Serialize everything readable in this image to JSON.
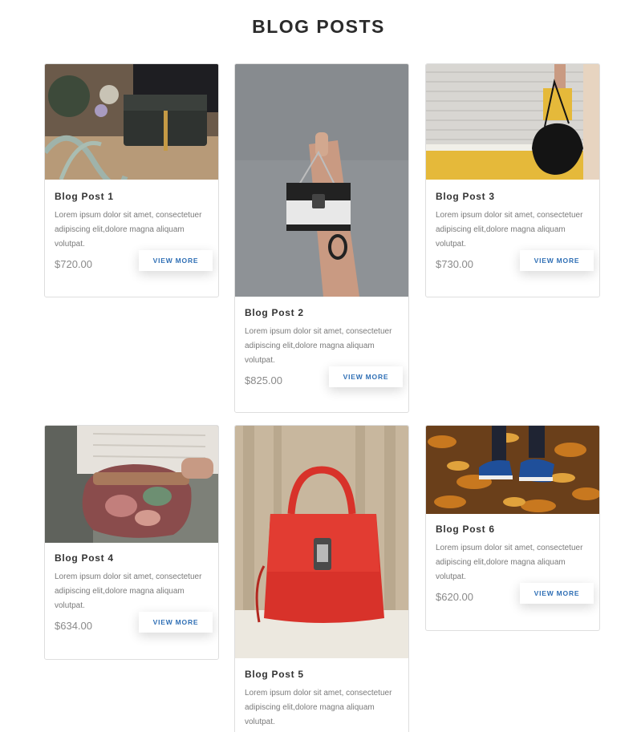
{
  "page": {
    "title": "BLOG POSTS"
  },
  "posts": [
    {
      "title": "Blog Post 1",
      "text": "Lorem ipsum dolor sit amet, consectetuer adipiscing elit,dolore magna aliquam volutpat.",
      "price": "$720.00",
      "button": "VIEW MORE",
      "image_icon": "black-clutch-photo"
    },
    {
      "title": "Blog Post 2",
      "text": "Lorem ipsum dolor sit amet, consectetuer adipiscing elit,dolore magna aliquam volutpat.",
      "price": "$825.00",
      "button": "VIEW MORE",
      "image_icon": "hand-holding-bag-photo"
    },
    {
      "title": "Blog Post 3",
      "text": "Lorem ipsum dolor sit amet, consectetuer adipiscing elit,dolore magna aliquam volutpat.",
      "price": "$730.00",
      "button": "VIEW MORE",
      "image_icon": "woman-shoulder-bag-photo"
    },
    {
      "title": "Blog Post 4",
      "text": "Lorem ipsum dolor sit amet, consectetuer adipiscing elit,dolore magna aliquam volutpat.",
      "price": "$634.00",
      "button": "VIEW MORE",
      "image_icon": "patterned-handbag-photo"
    },
    {
      "title": "Blog Post 5",
      "text": "Lorem ipsum dolor sit amet, consectetuer adipiscing elit,dolore magna aliquam volutpat.",
      "price": "",
      "button": "",
      "image_icon": "red-handbag-photo"
    },
    {
      "title": "Blog Post 6",
      "text": "Lorem ipsum dolor sit amet, consectetuer adipiscing elit,dolore magna aliquam volutpat.",
      "price": "$620.00",
      "button": "VIEW MORE",
      "image_icon": "sneakers-autumn-leaves-photo"
    }
  ],
  "colors": {
    "button_text": "#2f6fb5",
    "title": "#2b2b2b",
    "body_text": "#7a7a7a",
    "border": "#dedede"
  }
}
